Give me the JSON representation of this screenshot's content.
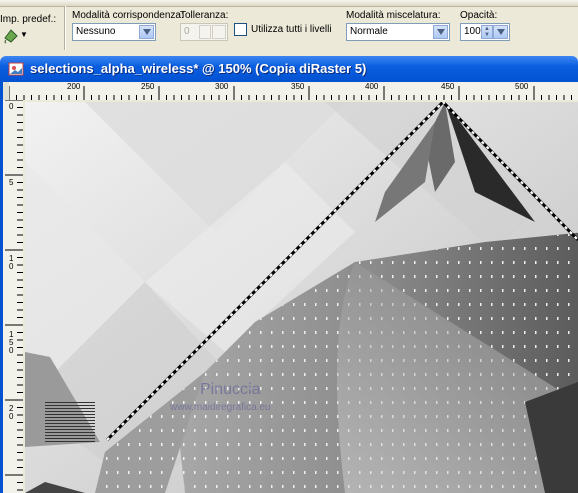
{
  "toolbar": {
    "preset_label": "Imp. predef.:",
    "match_mode_label": "Modalità corrispondenza:",
    "match_mode_value": "Nessuno",
    "tolerance_label": "Tolleranza:",
    "tolerance_value": "0",
    "use_all_layers_label": "Utilizza tutti i livelli",
    "use_all_layers_checked": false,
    "blend_mode_label": "Modalità miscelatura:",
    "blend_mode_value": "Normale",
    "opacity_label": "Opacità:",
    "opacity_value": "100"
  },
  "window": {
    "title": "selections_alpha_wireless* @ 150% (Copia diRaster 5)"
  },
  "ruler": {
    "horizontal_ticks": [
      "200",
      "250",
      "300",
      "350",
      "400",
      "450",
      "500"
    ],
    "vertical_ticks": [
      "0",
      "5",
      "1",
      "0",
      "1",
      "5",
      "0",
      "2",
      "0"
    ]
  },
  "watermark": {
    "name": "Pinuccia",
    "url": "www.maidiregrafica.eu"
  },
  "colors": {
    "title_bar": "#0352d2",
    "selection": "#ffffff"
  }
}
